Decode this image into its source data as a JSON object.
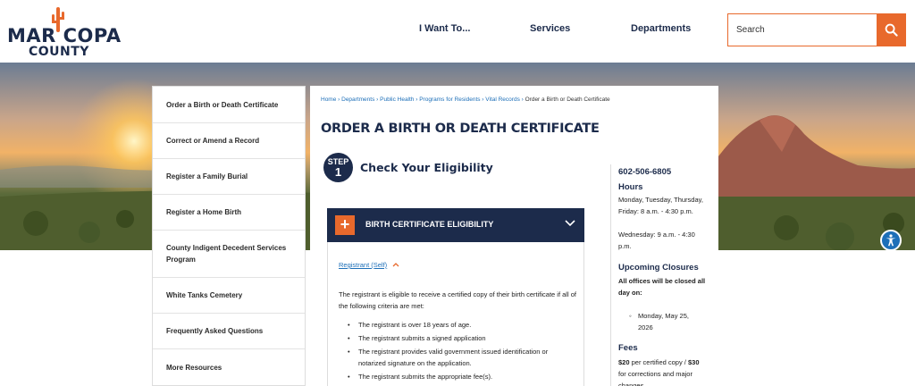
{
  "logo": {
    "line1": "MAR  COPA",
    "line2": "COUNTY"
  },
  "nav": [
    "I Want To...",
    "Services",
    "Departments"
  ],
  "search": {
    "placeholder": "Search"
  },
  "sidebar": {
    "items": [
      {
        "label": "Order a Birth or Death Certificate"
      },
      {
        "label": "Correct or Amend a Record"
      },
      {
        "label": "Register a Family Burial"
      },
      {
        "label": "Register a Home Birth"
      },
      {
        "label": "County Indigent Decedent Services Program"
      },
      {
        "label": "White Tanks Cemetery"
      },
      {
        "label": "Frequently Asked Questions"
      },
      {
        "label": "More Resources"
      }
    ]
  },
  "breadcrumb": {
    "links": [
      "Home",
      "Departments",
      "Public Health",
      "Programs for Residents",
      "Vital Records"
    ],
    "separator": " › ",
    "current": "Order a Birth or Death Certificate"
  },
  "page": {
    "title": "ORDER A BIRTH OR DEATH CERTIFICATE"
  },
  "step": {
    "word": "STEP",
    "number": "1",
    "title": "Check Your Eligibility"
  },
  "accordion": {
    "plus": "+",
    "title": "BIRTH CERTIFICATE ELIGIBILITY",
    "sub_label": "Registrant (Self)",
    "paragraph": "The registrant is eligible to receive a certified copy of their birth certificate if all of the following criteria are met:",
    "bullets": [
      "The registrant is over 18 years of age.",
      "The registrant submits a signed application",
      "The registrant provides valid government issued identification or notarized signature on the application.",
      "The registrant submits the appropriate fee(s)."
    ]
  },
  "info": {
    "phone": "602-506-6805",
    "hours_title": "Hours",
    "hours_line1": "Monday, Tuesday, Thursday, Friday: 8 a.m. - 4:30 p.m.",
    "hours_line2": "Wednesday: 9 a.m. - 4:30 p.m.",
    "closures_title": "Upcoming Closures",
    "closures_note": "All offices will be closed all day on:",
    "closures_date": "Monday, May 25, 2026",
    "fees_title": "Fees",
    "fee1_amount": "$20",
    "fee1_text": " per certified copy /",
    "fee2_amount": "$30",
    "fee2_text": " for corrections and major changes"
  },
  "colors": {
    "navy": "#1c2b4b",
    "orange": "#e8692c",
    "link": "#1d6fb8"
  }
}
